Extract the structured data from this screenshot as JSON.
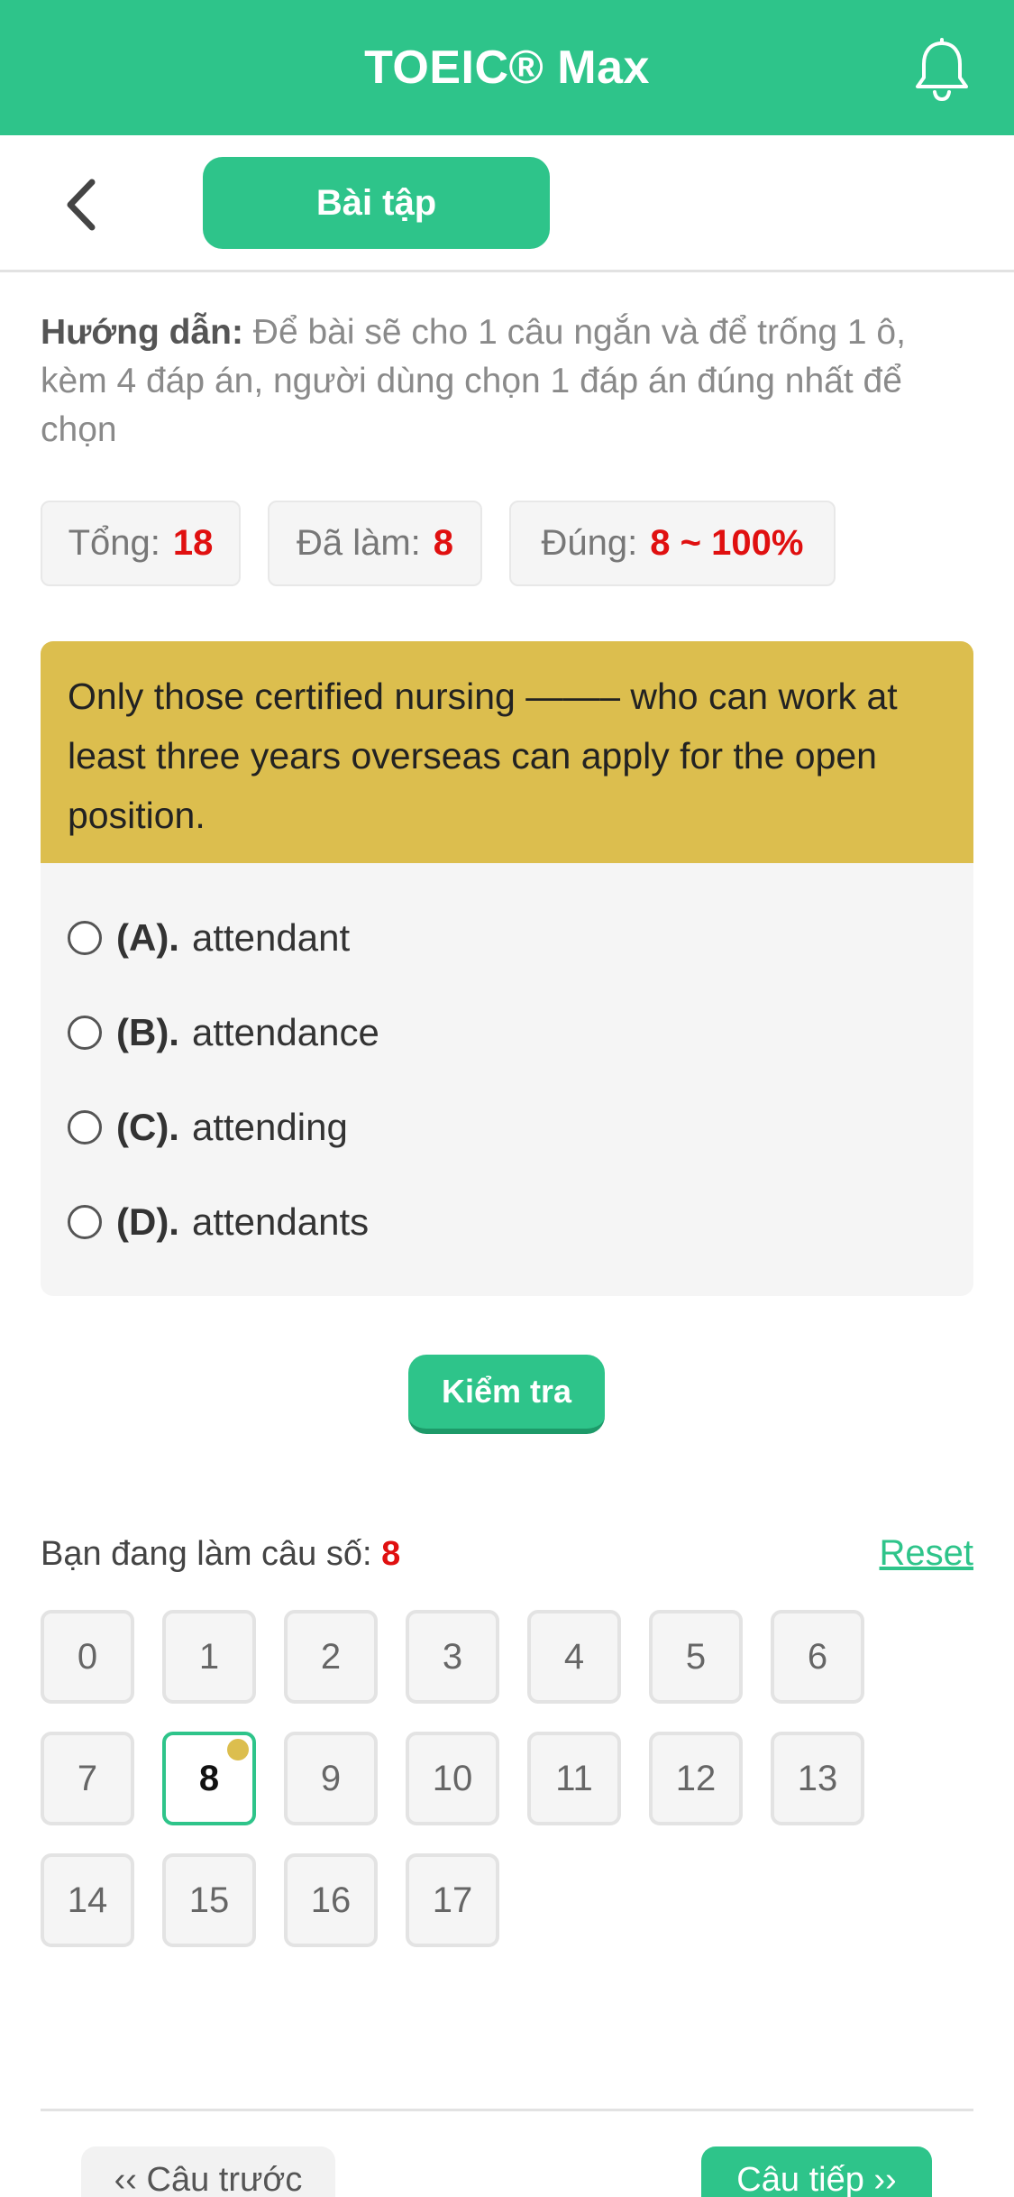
{
  "header": {
    "title": "TOEIC® Max",
    "bell_icon": "bell-icon",
    "accent_color": "#2ec48a"
  },
  "subheader": {
    "back_icon": "chevron-left-icon",
    "tab_label": "Bài tập"
  },
  "instructions": {
    "lead": "Hướng dẫn:",
    "text": " Để bài sẽ cho 1 câu ngắn và để trống 1 ô, kèm 4 đáp án, người dùng chọn 1 đáp án đúng nhất để chọn"
  },
  "stats": {
    "total_label": "Tổng:",
    "total_value": "18",
    "done_label": "Đã làm:",
    "done_value": "8",
    "correct_label": "Đúng:",
    "correct_value": "8 ~ 100%"
  },
  "question": {
    "text": "Only those certified nursing ——– who can work at least three years overseas can apply for the open position.",
    "card_color": "#dcbe4e",
    "options": [
      {
        "key": "(A).",
        "text": "attendant"
      },
      {
        "key": "(B).",
        "text": "attendance"
      },
      {
        "key": "(C).",
        "text": "attending"
      },
      {
        "key": "(D).",
        "text": "attendants"
      }
    ]
  },
  "check_button": "Kiểm tra",
  "progress": {
    "current_label": "Bạn đang làm câu số:",
    "current_number": "8",
    "reset_label": "Reset",
    "questions": [
      "0",
      "1",
      "2",
      "3",
      "4",
      "5",
      "6",
      "7",
      "8",
      "9",
      "10",
      "11",
      "12",
      "13",
      "14",
      "15",
      "16",
      "17"
    ],
    "active_index": 8
  },
  "nav": {
    "prev_label": "‹‹ Câu trước",
    "next_label": "Câu tiếp ››"
  }
}
